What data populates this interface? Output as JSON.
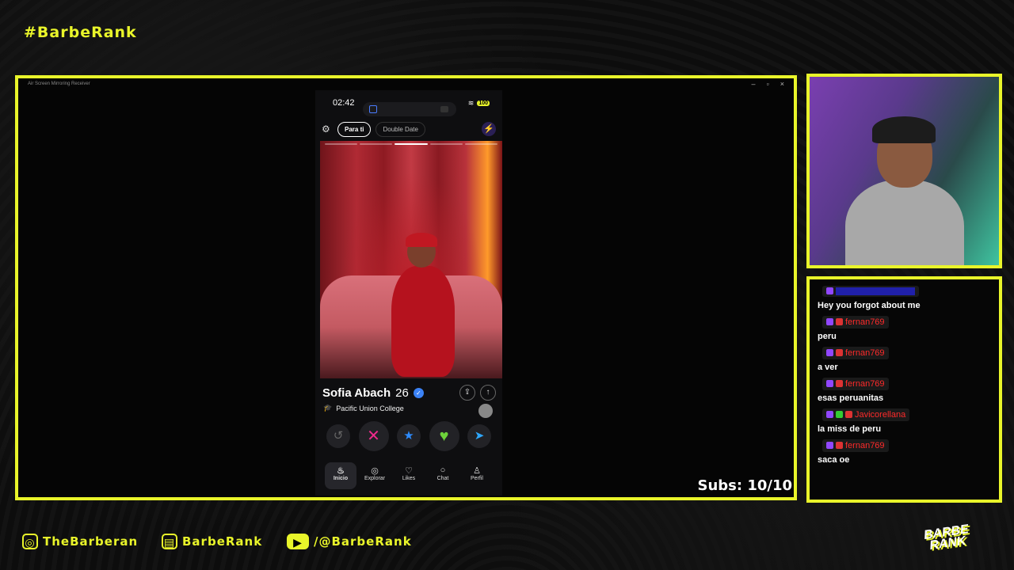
{
  "overlay": {
    "hashtag": "#BarbeRank",
    "subs": "Subs: 10/10"
  },
  "window": {
    "title": "Air Screen Mirroring Receiver",
    "minimize": "–",
    "maximize": "▫",
    "close": "×"
  },
  "phone": {
    "time": "02:42",
    "battery": "100",
    "tabs": [
      {
        "label": "Para ti",
        "active": true
      },
      {
        "label": "Double Date",
        "active": false
      }
    ],
    "profile": {
      "name": "Sofia Abach",
      "age": "26",
      "school": "Pacific Union College"
    },
    "nav": [
      {
        "label": "Inicio",
        "icon": "flame-icon",
        "active": true
      },
      {
        "label": "Explorar",
        "icon": "compass-icon"
      },
      {
        "label": "Likes",
        "icon": "heart-icon"
      },
      {
        "label": "Chat",
        "icon": "chat-icon"
      },
      {
        "label": "Perfil",
        "icon": "person-icon"
      }
    ]
  },
  "chat": [
    {
      "user": "",
      "text": "Hey you forgot about me",
      "user_color": "#3b3bff"
    },
    {
      "user": "fernan769",
      "text": "peru",
      "user_color": "#ff2a2a"
    },
    {
      "user": "fernan769",
      "text": "a ver",
      "user_color": "#ff2a2a"
    },
    {
      "user": "fernan769",
      "text": "esas peruanitas",
      "user_color": "#ff2a2a"
    },
    {
      "user": "Javicorellana",
      "text": "la miss de peru",
      "user_color": "#ff2a2a"
    },
    {
      "user": "fernan769",
      "text": "saca oe",
      "user_color": "#ff2a2a"
    }
  ],
  "footer": {
    "instagram": "TheBarberan",
    "twitch": "BarbeRank",
    "youtube": "/@BarbeRank",
    "logo_line1": "BARBE",
    "logo_line2": "RANK"
  },
  "colors": {
    "accent": "#e9f52a"
  }
}
